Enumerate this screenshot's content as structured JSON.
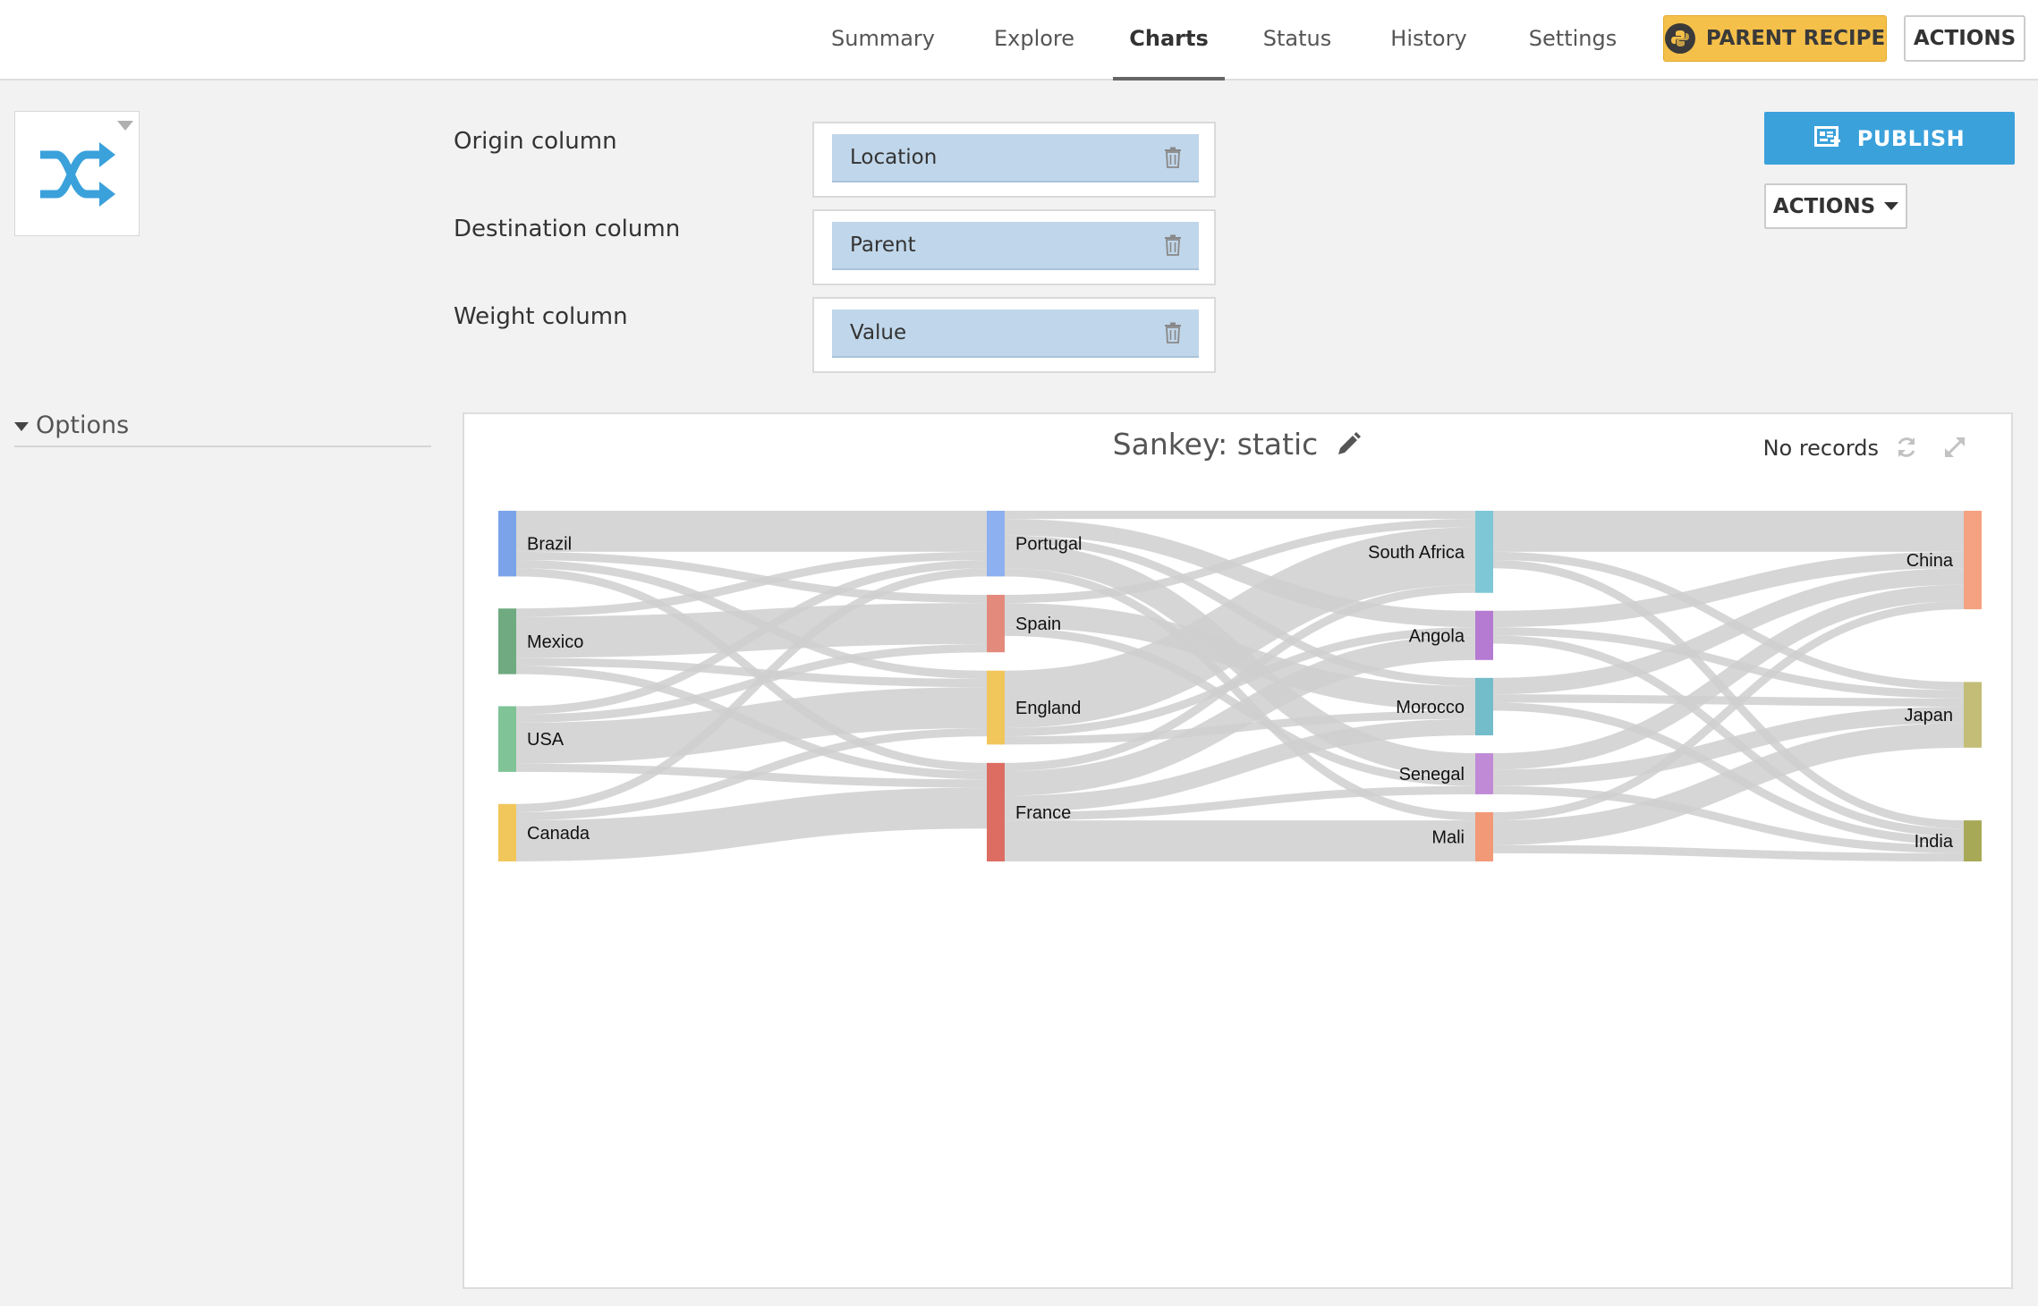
{
  "nav": {
    "tabs": [
      {
        "label": "Summary"
      },
      {
        "label": "Explore"
      },
      {
        "label": "Charts"
      },
      {
        "label": "Status"
      },
      {
        "label": "History"
      },
      {
        "label": "Settings"
      }
    ],
    "parent_recipe_label": "PARENT RECIPE",
    "actions_label": "ACTIONS"
  },
  "chart_type": {
    "icon": "shuffle-icon",
    "icon_color": "#3aa1db"
  },
  "columns": {
    "origin": {
      "label": "Origin column",
      "value": "Location"
    },
    "destination": {
      "label": "Destination column",
      "value": "Parent"
    },
    "weight": {
      "label": "Weight column",
      "value": "Value"
    }
  },
  "right_panel": {
    "publish_label": "PUBLISH",
    "actions_label": "ACTIONS"
  },
  "options": {
    "label": "Options"
  },
  "chart": {
    "title": "Sankey: static",
    "records_label": "No records"
  },
  "chart_data": {
    "type": "sankey",
    "title": "Sankey: static",
    "columns": [
      [
        {
          "name": "Brazil",
          "color": "#7ba3ea"
        },
        {
          "name": "Mexico",
          "color": "#6faa80"
        },
        {
          "name": "USA",
          "color": "#7fc397"
        },
        {
          "name": "Canada",
          "color": "#f1c65b"
        }
      ],
      [
        {
          "name": "Portugal",
          "color": "#8cb0f0"
        },
        {
          "name": "Spain",
          "color": "#e38a7d"
        },
        {
          "name": "England",
          "color": "#f1c65b"
        },
        {
          "name": "France",
          "color": "#dd6d62"
        }
      ],
      [
        {
          "name": "South Africa",
          "color": "#7ec7d6"
        },
        {
          "name": "Angola",
          "color": "#b57ad2"
        },
        {
          "name": "Morocco",
          "color": "#73bcc9"
        },
        {
          "name": "Senegal",
          "color": "#c08ad6"
        },
        {
          "name": "Mali",
          "color": "#f29a78"
        }
      ],
      [
        {
          "name": "China",
          "color": "#f4a281"
        },
        {
          "name": "Japan",
          "color": "#c3bd77"
        },
        {
          "name": "India",
          "color": "#a8a957"
        }
      ]
    ],
    "links": [
      {
        "source": "Brazil",
        "target": "Portugal",
        "value": 5
      },
      {
        "source": "Brazil",
        "target": "Spain",
        "value": 1
      },
      {
        "source": "Brazil",
        "target": "England",
        "value": 1
      },
      {
        "source": "Brazil",
        "target": "France",
        "value": 1
      },
      {
        "source": "Mexico",
        "target": "Portugal",
        "value": 1
      },
      {
        "source": "Mexico",
        "target": "Spain",
        "value": 5
      },
      {
        "source": "Mexico",
        "target": "England",
        "value": 1
      },
      {
        "source": "Mexico",
        "target": "France",
        "value": 1
      },
      {
        "source": "USA",
        "target": "Portugal",
        "value": 1
      },
      {
        "source": "USA",
        "target": "Spain",
        "value": 1
      },
      {
        "source": "USA",
        "target": "England",
        "value": 5
      },
      {
        "source": "USA",
        "target": "France",
        "value": 1
      },
      {
        "source": "Canada",
        "target": "Portugal",
        "value": 1
      },
      {
        "source": "Canada",
        "target": "England",
        "value": 1
      },
      {
        "source": "Canada",
        "target": "France",
        "value": 5
      },
      {
        "source": "Portugal",
        "target": "South Africa",
        "value": 1
      },
      {
        "source": "Portugal",
        "target": "Angola",
        "value": 2
      },
      {
        "source": "Portugal",
        "target": "Morocco",
        "value": 1
      },
      {
        "source": "Portugal",
        "target": "Senegal",
        "value": 3
      },
      {
        "source": "Portugal",
        "target": "Mali",
        "value": 1
      },
      {
        "source": "Spain",
        "target": "South Africa",
        "value": 1
      },
      {
        "source": "Spain",
        "target": "Morocco",
        "value": 3
      },
      {
        "source": "Spain",
        "target": "Senegal",
        "value": 1
      },
      {
        "source": "England",
        "target": "South Africa",
        "value": 7
      },
      {
        "source": "England",
        "target": "Angola",
        "value": 1
      },
      {
        "source": "England",
        "target": "Morocco",
        "value": 1
      },
      {
        "source": "France",
        "target": "South Africa",
        "value": 1
      },
      {
        "source": "France",
        "target": "Angola",
        "value": 3
      },
      {
        "source": "France",
        "target": "Morocco",
        "value": 2
      },
      {
        "source": "France",
        "target": "Senegal",
        "value": 1
      },
      {
        "source": "France",
        "target": "Mali",
        "value": 5
      },
      {
        "source": "South Africa",
        "target": "China",
        "value": 5
      },
      {
        "source": "South Africa",
        "target": "Japan",
        "value": 1
      },
      {
        "source": "South Africa",
        "target": "India",
        "value": 1
      },
      {
        "source": "South Africa",
        "target": "Mali",
        "value": 0
      },
      {
        "source": "Angola",
        "target": "China",
        "value": 2
      },
      {
        "source": "Angola",
        "target": "Japan",
        "value": 1
      },
      {
        "source": "Angola",
        "target": "India",
        "value": 1
      },
      {
        "source": "Morocco",
        "target": "China",
        "value": 2
      },
      {
        "source": "Morocco",
        "target": "Japan",
        "value": 1
      },
      {
        "source": "Morocco",
        "target": "India",
        "value": 1
      },
      {
        "source": "Senegal",
        "target": "China",
        "value": 2
      },
      {
        "source": "Senegal",
        "target": "Japan",
        "value": 2
      },
      {
        "source": "Senegal",
        "target": "India",
        "value": 1
      },
      {
        "source": "Mali",
        "target": "China",
        "value": 1
      },
      {
        "source": "Mali",
        "target": "Japan",
        "value": 3
      },
      {
        "source": "Mali",
        "target": "India",
        "value": 1
      }
    ],
    "link_color": "#cfcfcf"
  }
}
